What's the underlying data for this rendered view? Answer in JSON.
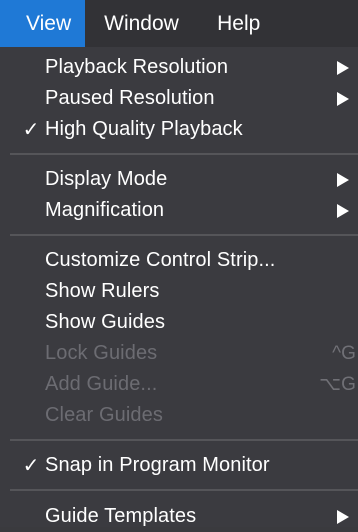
{
  "menubar": {
    "items": [
      {
        "label": "View"
      },
      {
        "label": "Window"
      },
      {
        "label": "Help"
      }
    ]
  },
  "menu": {
    "playback_resolution": "Playback Resolution",
    "paused_resolution": "Paused Resolution",
    "high_quality_playback": "High Quality Playback",
    "display_mode": "Display Mode",
    "magnification": "Magnification",
    "customize_control_strip": "Customize Control Strip...",
    "show_rulers": "Show Rulers",
    "show_guides": "Show Guides",
    "lock_guides": "Lock Guides",
    "lock_guides_shortcut": "^G",
    "add_guide": "Add Guide...",
    "add_guide_shortcut": "⌥G",
    "clear_guides": "Clear Guides",
    "snap_in_program_monitor": "Snap in Program Monitor",
    "guide_templates": "Guide Templates",
    "checkmark": "✓"
  },
  "colors": {
    "menubar_active": "#1f79d6",
    "menu_background": "#3b3b40",
    "disabled_text": "#6c6c72"
  }
}
